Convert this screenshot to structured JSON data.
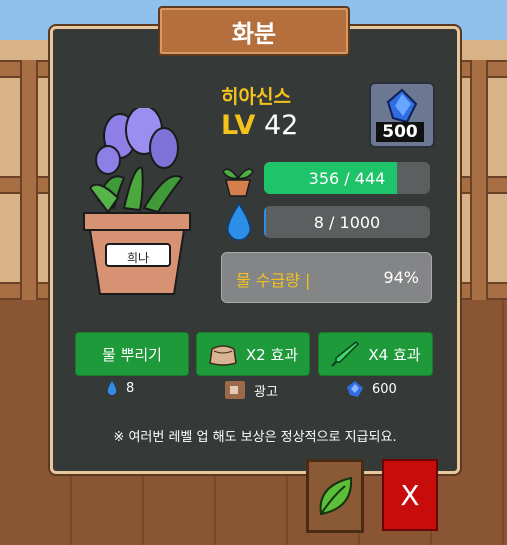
{
  "title": "화분",
  "plant": {
    "name": "히아신스",
    "level_prefix": "LV",
    "level": "42",
    "pot_tag": "희나"
  },
  "gem": {
    "count": "500",
    "icon": "blue-gem-icon"
  },
  "growth": {
    "text": "356 / 444",
    "current": 356,
    "max": 444,
    "color": "#1fc46a",
    "icon": "sprout-pot-icon"
  },
  "water": {
    "text": "8 / 1000",
    "current": 8,
    "max": 1000,
    "icon": "water-drop-icon"
  },
  "water_supply": {
    "label": "물 수급량 |",
    "percent": "94%"
  },
  "actions": [
    {
      "label": "물 뿌리기",
      "cost_text": "8",
      "cost_icon": "water-drop-icon"
    },
    {
      "label": "X2 효과",
      "cost_text": "광고",
      "cost_icon": "ad-icon",
      "icon": "fertilizer-bag-icon"
    },
    {
      "label": "X4 효과",
      "cost_text": "600",
      "cost_icon": "blue-gem-icon",
      "icon": "syringe-icon"
    }
  ],
  "notice": "※ 여러번 레벨 업 해도 보상은 정상적으로 지급되요.",
  "close_label": "X",
  "colors": {
    "panel": "#353a38",
    "accent_yellow": "#f4c21b",
    "button_green": "#1f9a3a",
    "close_red": "#c70c0c"
  }
}
